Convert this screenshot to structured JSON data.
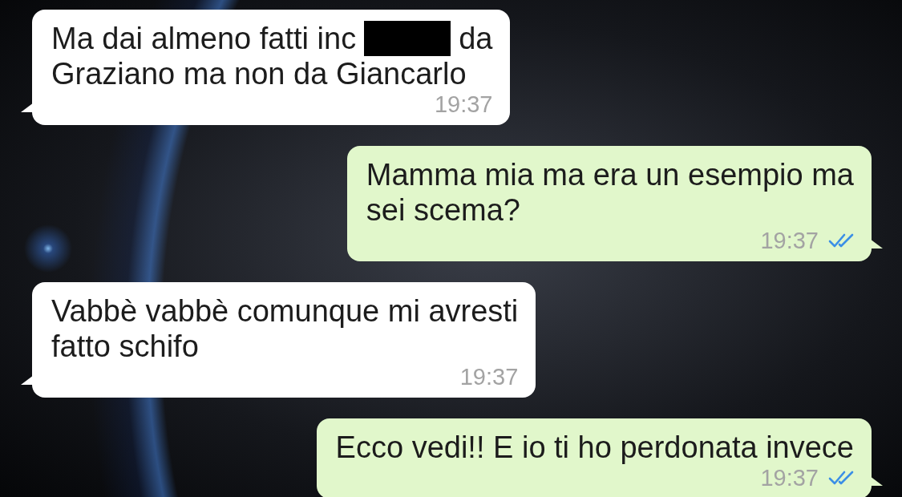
{
  "messages": [
    {
      "kind": "incoming",
      "lines": [
        [
          {
            "kind": "text",
            "text": "Ma dai almeno fatti inc"
          },
          {
            "kind": "redacted"
          },
          {
            "kind": "text",
            "text": "da"
          }
        ],
        [
          {
            "kind": "text",
            "text": "Graziano ma non da Giancarlo"
          }
        ]
      ],
      "time": "19:37"
    },
    {
      "kind": "outgoing",
      "lines": [
        [
          {
            "kind": "text",
            "text": "Mamma mia ma era un esempio ma"
          }
        ],
        [
          {
            "kind": "text",
            "text": "sei scema?"
          }
        ]
      ],
      "time": "19:37",
      "read": true
    },
    {
      "kind": "incoming",
      "lines": [
        [
          {
            "kind": "text",
            "text": "Vabbè vabbè comunque mi avresti"
          }
        ],
        [
          {
            "kind": "text",
            "text": "fatto schifo"
          }
        ]
      ],
      "time": "19:37"
    },
    {
      "kind": "outgoing",
      "lines": [
        [
          {
            "kind": "text",
            "text": "Ecco vedi!! E io ti ho perdonata invece"
          }
        ]
      ],
      "time": "19:37",
      "read": true
    }
  ]
}
